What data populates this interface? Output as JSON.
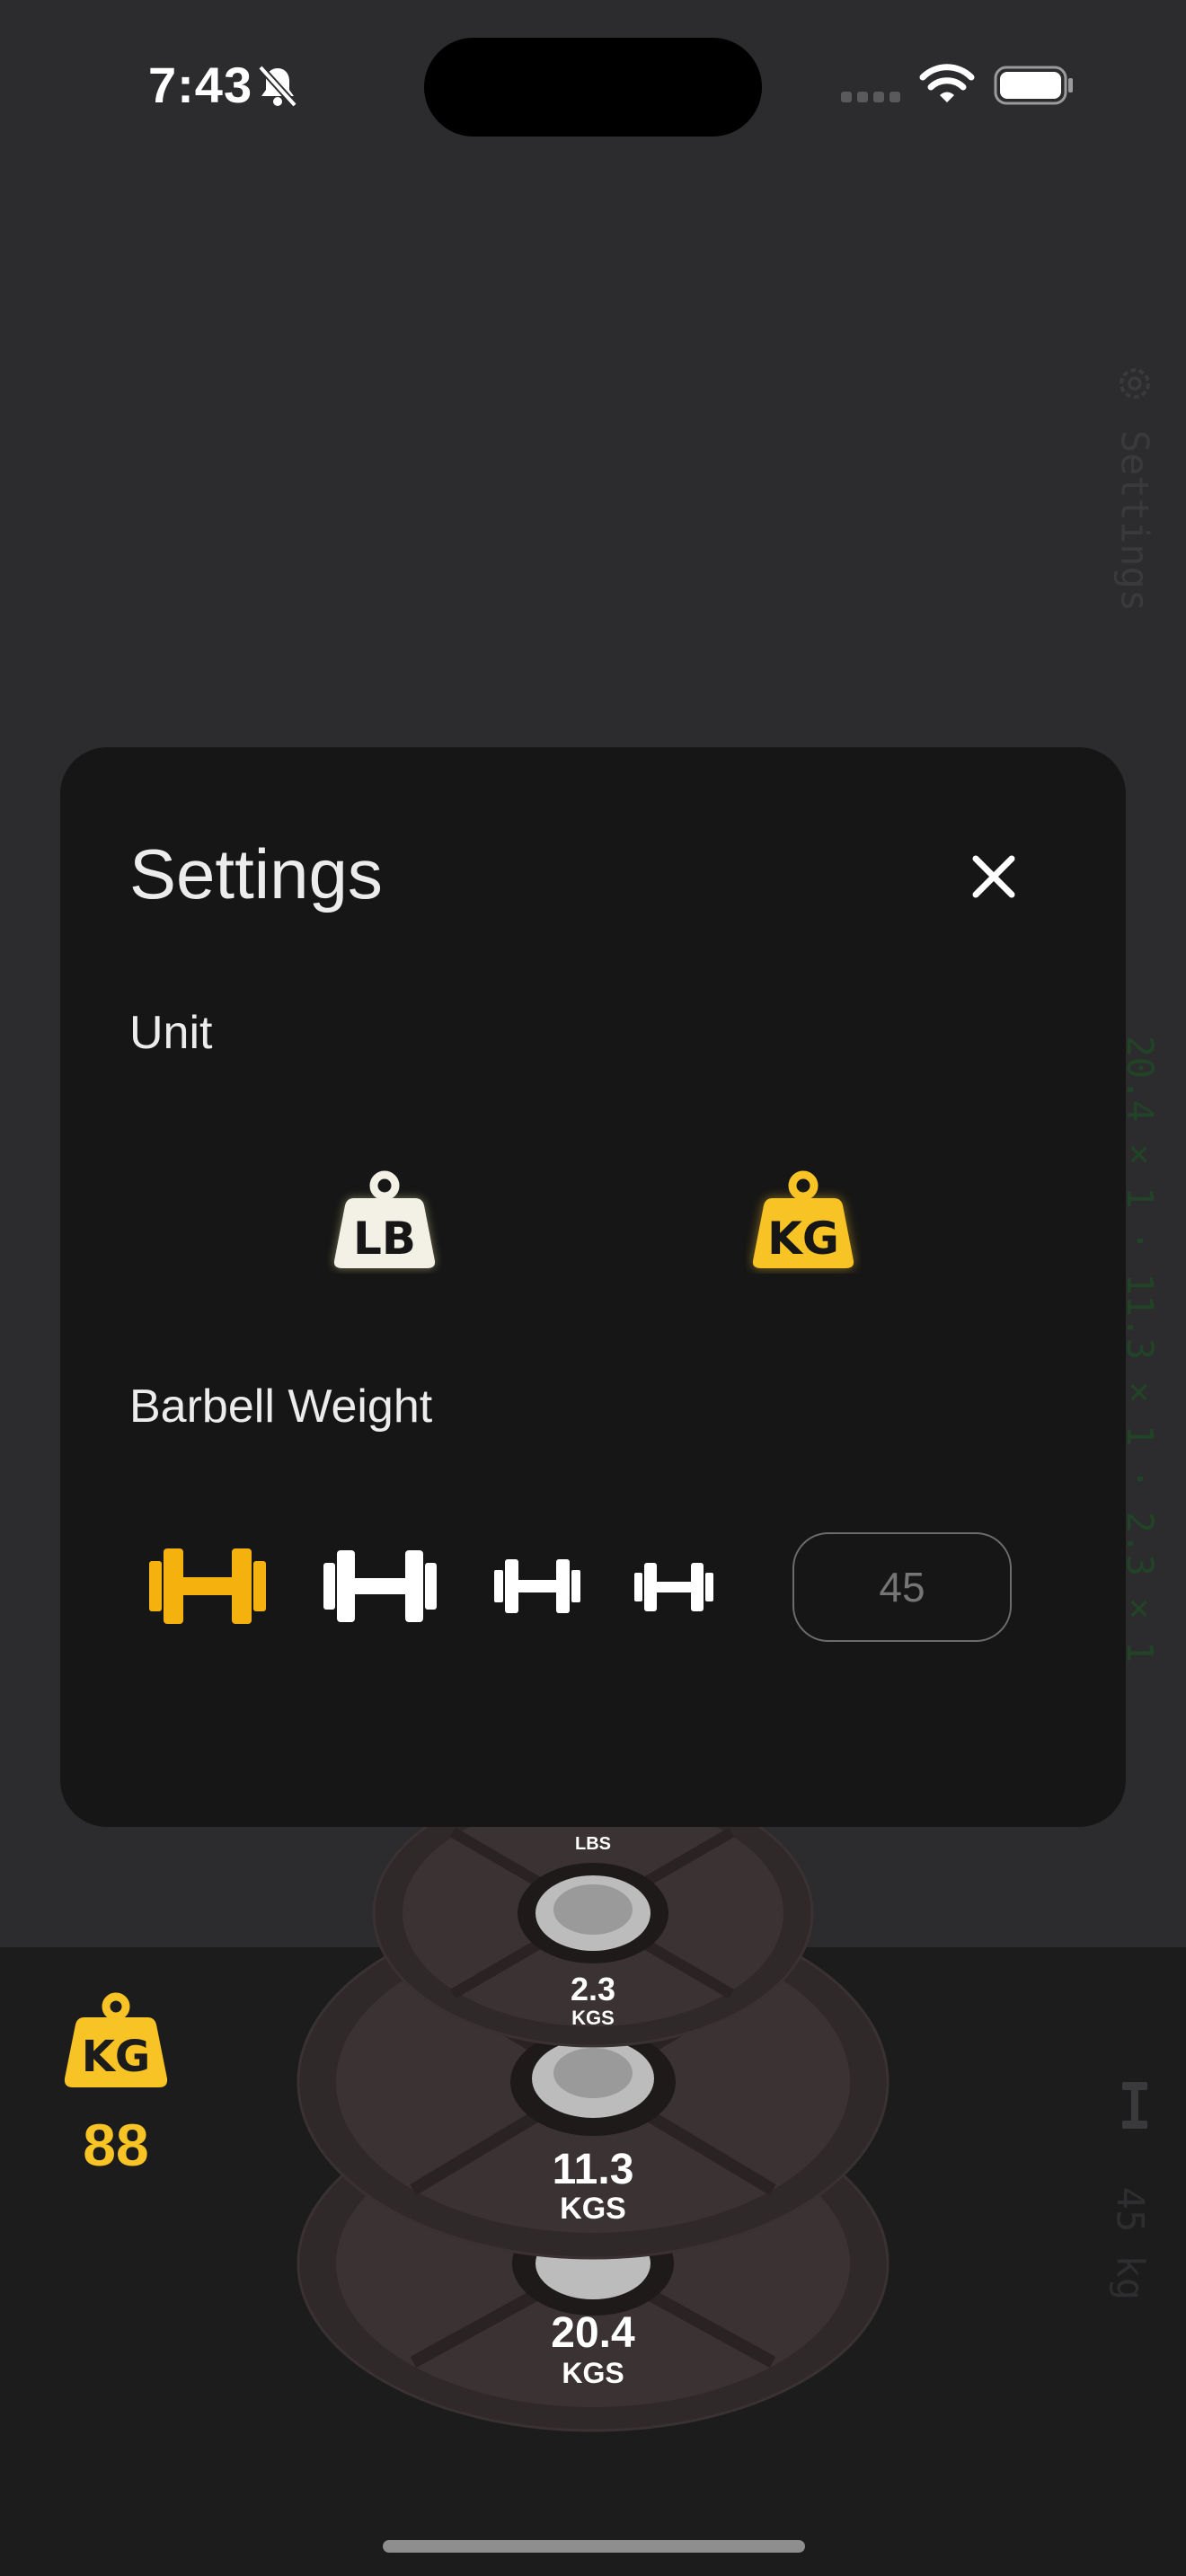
{
  "status_bar": {
    "time": "7:43"
  },
  "side": {
    "settings_label": "Settings",
    "plates_summary": "20.4 × 1 · 11.3 × 1 · 2.3 × 1",
    "bar_weight": "45 kg"
  },
  "plates": [
    {
      "value": "20.4",
      "unit": "KGS"
    },
    {
      "value": "11.3",
      "unit": "KGS"
    },
    {
      "value": "2.3",
      "unit": "KGS",
      "secondary_unit": "LBS"
    }
  ],
  "total": {
    "value": "88"
  },
  "settings": {
    "title": "Settings",
    "unit_label": "Unit",
    "units": [
      {
        "text": "LB",
        "selected": false
      },
      {
        "text": "KG",
        "selected": true
      }
    ],
    "barbell_label": "Barbell Weight",
    "barbell_options": [
      "large",
      "medium",
      "small",
      "extra-small"
    ],
    "barbell_selected_index": 0,
    "custom_barbell_placeholder": "45"
  },
  "colors": {
    "accent": "#f7c325",
    "sheet": "#161616",
    "background": "#2c2c2e"
  }
}
